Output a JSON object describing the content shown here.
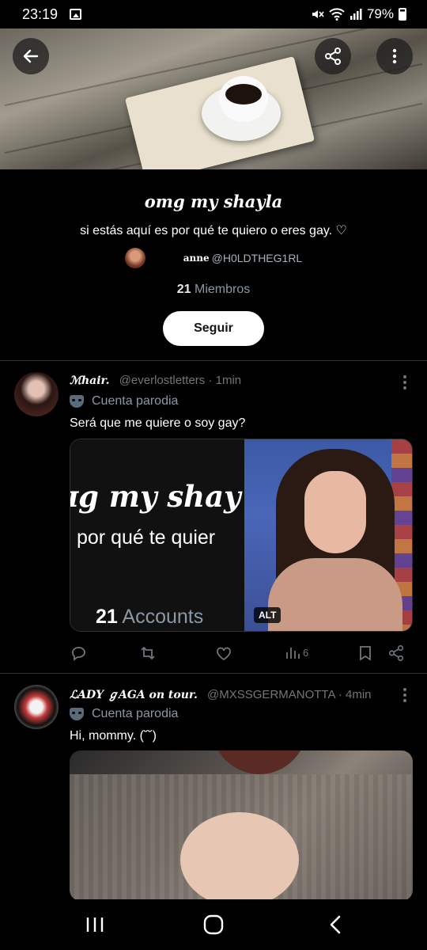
{
  "status_bar": {
    "time": "23:19",
    "battery": "79%",
    "icons": [
      "gallery-icon",
      "mute-icon",
      "wifi-icon",
      "signal-icon",
      "battery-icon"
    ]
  },
  "header": {
    "icons": [
      "back-arrow-icon",
      "share-icon",
      "more-vertical-icon"
    ]
  },
  "community": {
    "title": "omg my shayla",
    "description": "si estás aquí es por qué te quiero o eres gay. ♡",
    "creator_name": "anne",
    "creator_handle": "@H0LDTHEG1RL",
    "member_count": "21",
    "members_label": "Miembros",
    "follow_label": "Seguir"
  },
  "posts": [
    {
      "display_name": "ℳhair.",
      "handle": "@everlostletters",
      "time": "· 1min",
      "badge": "Cuenta parodia",
      "text": "Será que me quiere o soy gay?",
      "media": {
        "zoom_title": "ɪg my shay",
        "zoom_desc": "por qué te quier",
        "zoom_count": "21",
        "zoom_label": "Accounts",
        "alt_label": "ALT"
      },
      "views": "6"
    },
    {
      "display_name": "ℒADY ℊAGA on tour.",
      "handle": "@MXSSGERMANOTTA",
      "time": "· 4min",
      "badge": "Cuenta parodia",
      "text": "Hi, mommy. (˘˘)"
    }
  ],
  "action_icons": [
    "reply-icon",
    "repost-icon",
    "like-icon",
    "views-icon",
    "bookmark-icon",
    "share-icon"
  ],
  "nav": {
    "icons": [
      "recents-icon",
      "home-icon",
      "back-icon"
    ]
  },
  "colors": {
    "background": "#000000",
    "muted_text": "#71767b",
    "follow_button": "#ffffff",
    "divider": "#2f3336"
  }
}
